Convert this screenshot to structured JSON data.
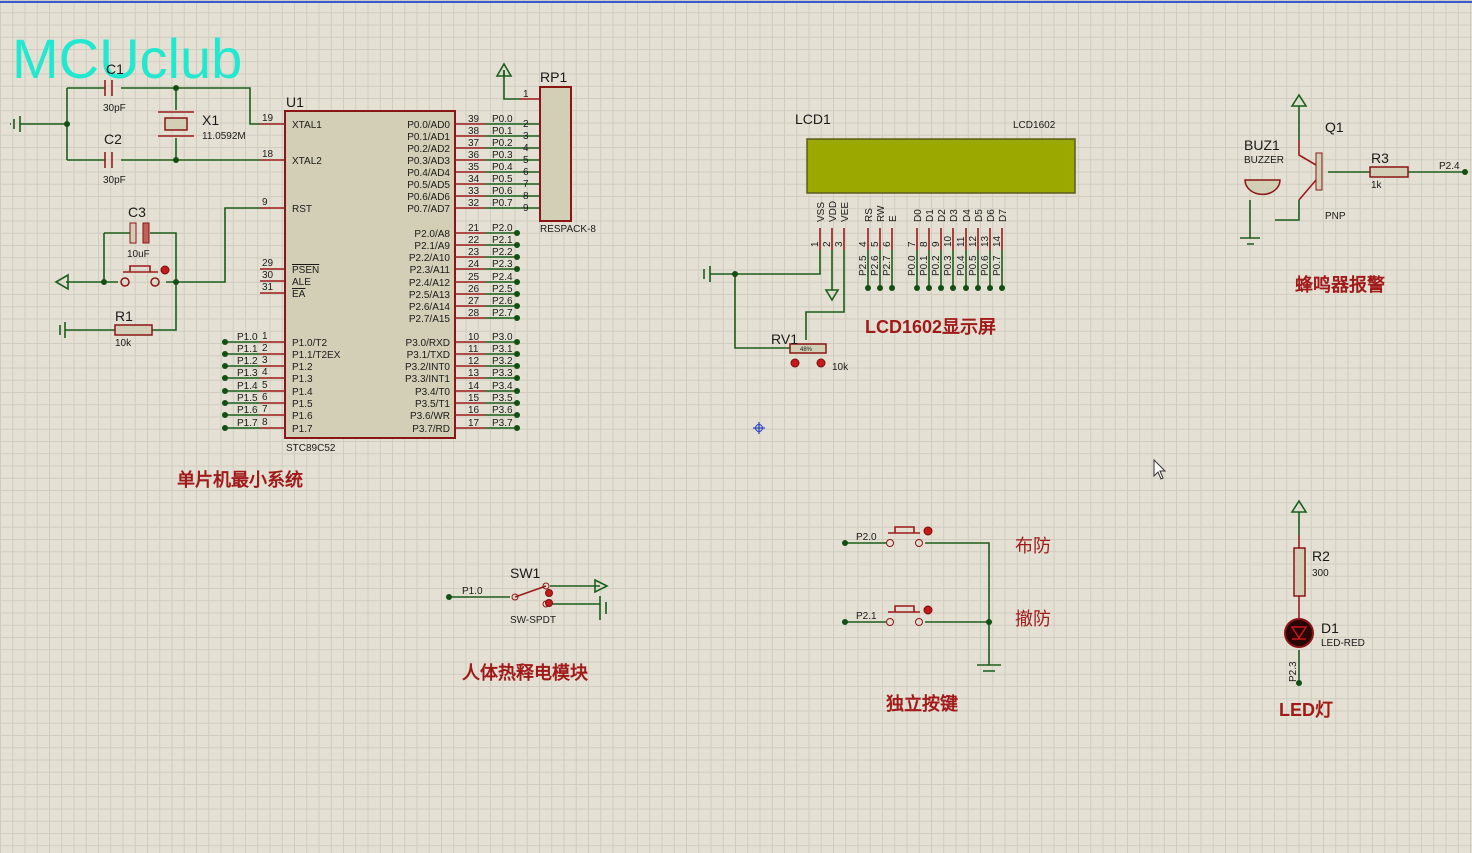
{
  "watermark": "MCUclub",
  "colors": {
    "wire": "#1b5e1b",
    "pin": "#9b1b1b",
    "title": "#a11a1a",
    "lcd_screen": "#9aa800",
    "watermark": "#22e8d0"
  },
  "mcu": {
    "ref": "U1",
    "part": "STC89C52",
    "left_pins": [
      {
        "num": "19",
        "name": "XTAL1"
      },
      {
        "num": "18",
        "name": "XTAL2"
      },
      {
        "num": "9",
        "name": "RST"
      },
      {
        "num": "29",
        "name": "PSEN"
      },
      {
        "num": "30",
        "name": "ALE"
      },
      {
        "num": "31",
        "name": "EA"
      },
      {
        "num": "1",
        "name": "P1.0/T2",
        "net": "P1.0"
      },
      {
        "num": "2",
        "name": "P1.1/T2EX",
        "net": "P1.1"
      },
      {
        "num": "3",
        "name": "P1.2",
        "net": "P1.2"
      },
      {
        "num": "4",
        "name": "P1.3",
        "net": "P1.3"
      },
      {
        "num": "5",
        "name": "P1.4",
        "net": "P1.4"
      },
      {
        "num": "6",
        "name": "P1.5",
        "net": "P1.5"
      },
      {
        "num": "7",
        "name": "P1.6",
        "net": "P1.6"
      },
      {
        "num": "8",
        "name": "P1.7",
        "net": "P1.7"
      }
    ],
    "right_pins": [
      {
        "num": "39",
        "name": "P0.0/AD0",
        "net": "P0.0",
        "rp": "2"
      },
      {
        "num": "38",
        "name": "P0.1/AD1",
        "net": "P0.1",
        "rp": "3"
      },
      {
        "num": "37",
        "name": "P0.2/AD2",
        "net": "P0.2",
        "rp": "4"
      },
      {
        "num": "36",
        "name": "P0.3/AD3",
        "net": "P0.3",
        "rp": "5"
      },
      {
        "num": "35",
        "name": "P0.4/AD4",
        "net": "P0.4",
        "rp": "6"
      },
      {
        "num": "34",
        "name": "P0.5/AD5",
        "net": "P0.5",
        "rp": "7"
      },
      {
        "num": "33",
        "name": "P0.6/AD6",
        "net": "P0.6",
        "rp": "8"
      },
      {
        "num": "32",
        "name": "P0.7/AD7",
        "net": "P0.7",
        "rp": "9"
      },
      {
        "num": "21",
        "name": "P2.0/A8",
        "net": "P2.0"
      },
      {
        "num": "22",
        "name": "P2.1/A9",
        "net": "P2.1"
      },
      {
        "num": "23",
        "name": "P2.2/A10",
        "net": "P2.2"
      },
      {
        "num": "24",
        "name": "P2.3/A11",
        "net": "P2.3"
      },
      {
        "num": "25",
        "name": "P2.4/A12",
        "net": "P2.4"
      },
      {
        "num": "26",
        "name": "P2.5/A13",
        "net": "P2.5"
      },
      {
        "num": "27",
        "name": "P2.6/A14",
        "net": "P2.6"
      },
      {
        "num": "28",
        "name": "P2.7/A15",
        "net": "P2.7"
      },
      {
        "num": "10",
        "name": "P3.0/RXD",
        "net": "P3.0"
      },
      {
        "num": "11",
        "name": "P3.1/TXD",
        "net": "P3.1"
      },
      {
        "num": "12",
        "name": "P3.2/INT0",
        "net": "P3.2"
      },
      {
        "num": "13",
        "name": "P3.3/INT1",
        "net": "P3.3"
      },
      {
        "num": "14",
        "name": "P3.4/T0",
        "net": "P3.4"
      },
      {
        "num": "15",
        "name": "P3.5/T1",
        "net": "P3.5"
      },
      {
        "num": "16",
        "name": "P3.6/WR",
        "net": "P3.6"
      },
      {
        "num": "17",
        "name": "P3.7/RD",
        "net": "P3.7"
      }
    ]
  },
  "min_system": {
    "c1": "C1",
    "c1_val": "30pF",
    "c2": "C2",
    "c2_val": "30pF",
    "x1": "X1",
    "x1_val": "11.0592M",
    "c3": "C3",
    "c3_val": "10uF",
    "r1": "R1",
    "r1_val": "10k",
    "title": "单片机最小系统"
  },
  "rp1": {
    "ref": "RP1",
    "part": "RESPACK-8",
    "pin1": "1"
  },
  "lcd": {
    "ref": "LCD1",
    "part": "LCD1602",
    "title": "LCD1602显示屏",
    "pins": [
      {
        "name": "VSS",
        "num": "1"
      },
      {
        "name": "VDD",
        "num": "2"
      },
      {
        "name": "VEE",
        "num": "3"
      },
      {
        "name": "RS",
        "num": "4",
        "net": "P2.5"
      },
      {
        "name": "RW",
        "num": "5",
        "net": "P2.6"
      },
      {
        "name": "E",
        "num": "6",
        "net": "P2.7"
      },
      {
        "name": "D0",
        "num": "7",
        "net": "P0.0"
      },
      {
        "name": "D1",
        "num": "8",
        "net": "P0.1"
      },
      {
        "name": "D2",
        "num": "9",
        "net": "P0.2"
      },
      {
        "name": "D3",
        "num": "10",
        "net": "P0.3"
      },
      {
        "name": "D4",
        "num": "11",
        "net": "P0.4"
      },
      {
        "name": "D5",
        "num": "12",
        "net": "P0.5"
      },
      {
        "name": "D6",
        "num": "13",
        "net": "P0.6"
      },
      {
        "name": "D7",
        "num": "14",
        "net": "P0.7"
      }
    ],
    "rv1": "RV1",
    "rv1_val": "10k",
    "rv1_pct": "48%"
  },
  "buzzer": {
    "buz": "BUZ1",
    "buz_val": "BUZZER",
    "q1": "Q1",
    "q1_val": "PNP",
    "r3": "R3",
    "r3_val": "1k",
    "net": "P2.4",
    "title": "蜂鸣器报警"
  },
  "pir": {
    "sw": "SW1",
    "sw_val": "SW-SPDT",
    "net": "P1.0",
    "title": "人体热释电模块"
  },
  "keys": {
    "k1_net": "P2.0",
    "k2_net": "P2.1",
    "k1_label": "布防",
    "k2_label": "撤防",
    "title": "独立按键"
  },
  "led": {
    "r2": "R2",
    "r2_val": "300",
    "d1": "D1",
    "d1_val": "LED-RED",
    "net": "P2.3",
    "title": "LED灯"
  }
}
